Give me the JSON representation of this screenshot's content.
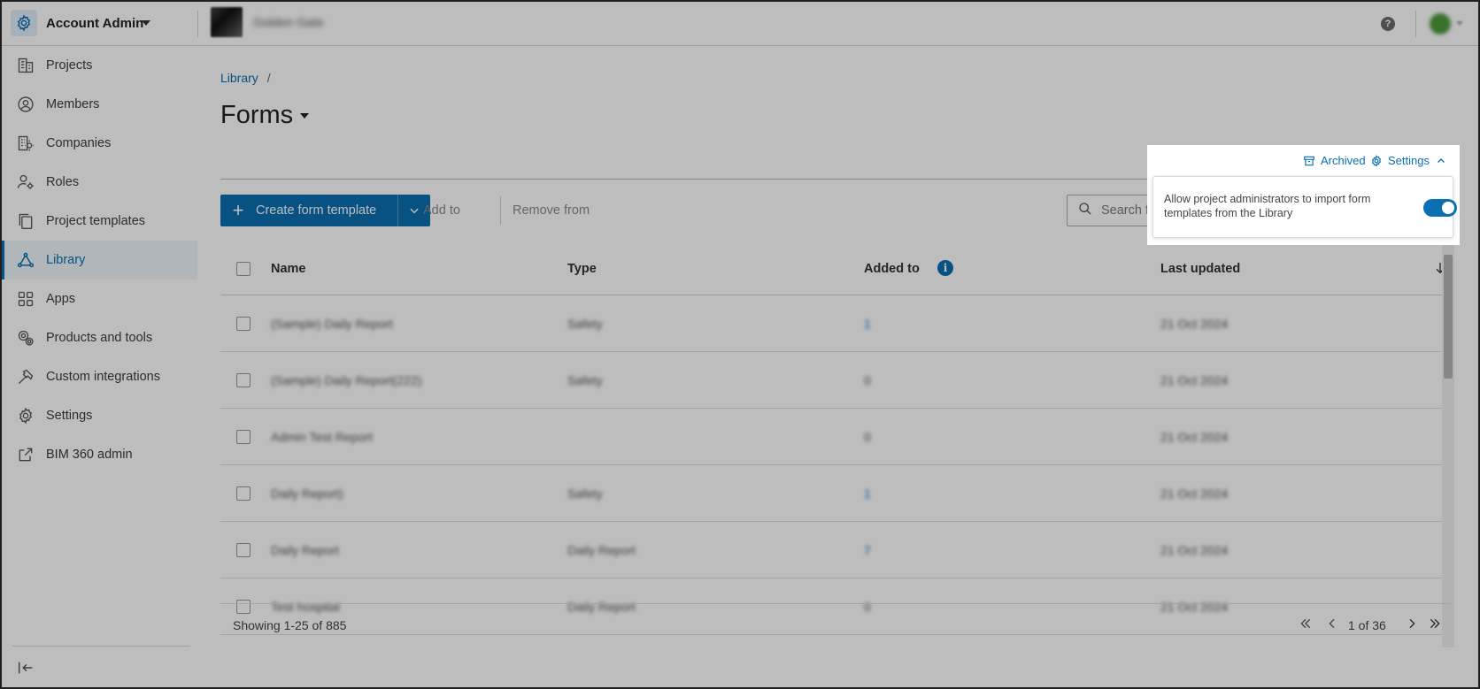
{
  "app": {
    "title": "Account Admin",
    "account_name": "Golden Gate"
  },
  "sidebar": {
    "items": [
      {
        "label": "Projects",
        "icon": "building-icon"
      },
      {
        "label": "Members",
        "icon": "user-circle-icon"
      },
      {
        "label": "Companies",
        "icon": "company-icon"
      },
      {
        "label": "Roles",
        "icon": "user-gear-icon"
      },
      {
        "label": "Project templates",
        "icon": "copy-icon"
      },
      {
        "label": "Library",
        "icon": "library-icon",
        "active": true
      },
      {
        "label": "Apps",
        "icon": "grid-icon"
      },
      {
        "label": "Products and tools",
        "icon": "gears-icon"
      },
      {
        "label": "Custom integrations",
        "icon": "hammer-icon"
      },
      {
        "label": "Settings",
        "icon": "gear-icon"
      },
      {
        "label": "BIM 360 admin",
        "icon": "external-link-icon"
      }
    ]
  },
  "breadcrumb": {
    "root": "Library",
    "sep": "/"
  },
  "page": {
    "title": "Forms"
  },
  "toolbar": {
    "create_label": "Create form template",
    "add_to": "Add to",
    "remove_from": "Remove from",
    "search_placeholder": "Search fo"
  },
  "table": {
    "headers": {
      "name": "Name",
      "type": "Type",
      "added_to": "Added to",
      "last_updated": "Last updated"
    },
    "rows": [
      {
        "name": "(Sample) Daily Report",
        "type": "Safety",
        "added_to": "1",
        "added_link": true,
        "last_updated": "21 Oct 2024"
      },
      {
        "name": "(Sample) Daily Report(222)",
        "type": "Safety",
        "added_to": "0",
        "added_link": false,
        "last_updated": "21 Oct 2024"
      },
      {
        "name": "Admin Test Report",
        "type": "",
        "added_to": "0",
        "added_link": false,
        "last_updated": "21 Oct 2024"
      },
      {
        "name": "Daily Report)",
        "type": "Safety",
        "added_to": "1",
        "added_link": true,
        "last_updated": "21 Oct 2024"
      },
      {
        "name": "Daily Report",
        "type": "Daily Report",
        "added_to": "7",
        "added_link": true,
        "last_updated": "21 Oct 2024"
      },
      {
        "name": "Test hospital",
        "type": "Daily Report",
        "added_to": "0",
        "added_link": false,
        "last_updated": "21 Oct 2024"
      }
    ]
  },
  "footer": {
    "showing": "Showing 1-25 of 885",
    "page": "1 of 36"
  },
  "popover": {
    "archived": "Archived",
    "settings": "Settings",
    "setting_text": "Allow project administrators to import form templates from the Library",
    "toggle_on": true
  },
  "colors": {
    "accent": "#0b6fb1",
    "overlay": "rgba(0,0,0,0.26)"
  }
}
